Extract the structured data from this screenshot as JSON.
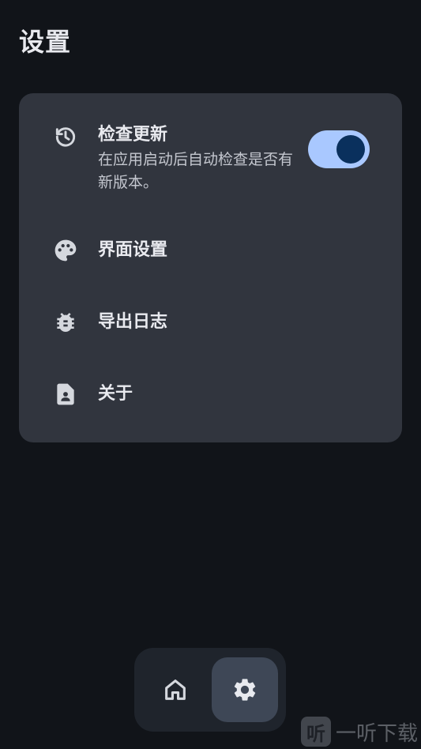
{
  "header": {
    "title": "设置"
  },
  "settings": {
    "items": [
      {
        "icon": "update-history-icon",
        "title": "检查更新",
        "description": "在应用启动后自动检查是否有新版本。",
        "toggle": true
      },
      {
        "icon": "palette-icon",
        "title": "界面设置"
      },
      {
        "icon": "bug-icon",
        "title": "导出日志"
      },
      {
        "icon": "contact-page-icon",
        "title": "关于"
      }
    ]
  },
  "nav": {
    "items": [
      {
        "icon": "home-icon",
        "selected": false
      },
      {
        "icon": "gear-icon",
        "selected": true
      }
    ]
  },
  "watermark": {
    "logo": "听",
    "text": "一听下载"
  },
  "colors": {
    "background": "#111419",
    "card": "#31353e",
    "toggle_track": "#a9c8ff",
    "toggle_knob": "#0a305d",
    "nav_selected": "#3e4756"
  }
}
